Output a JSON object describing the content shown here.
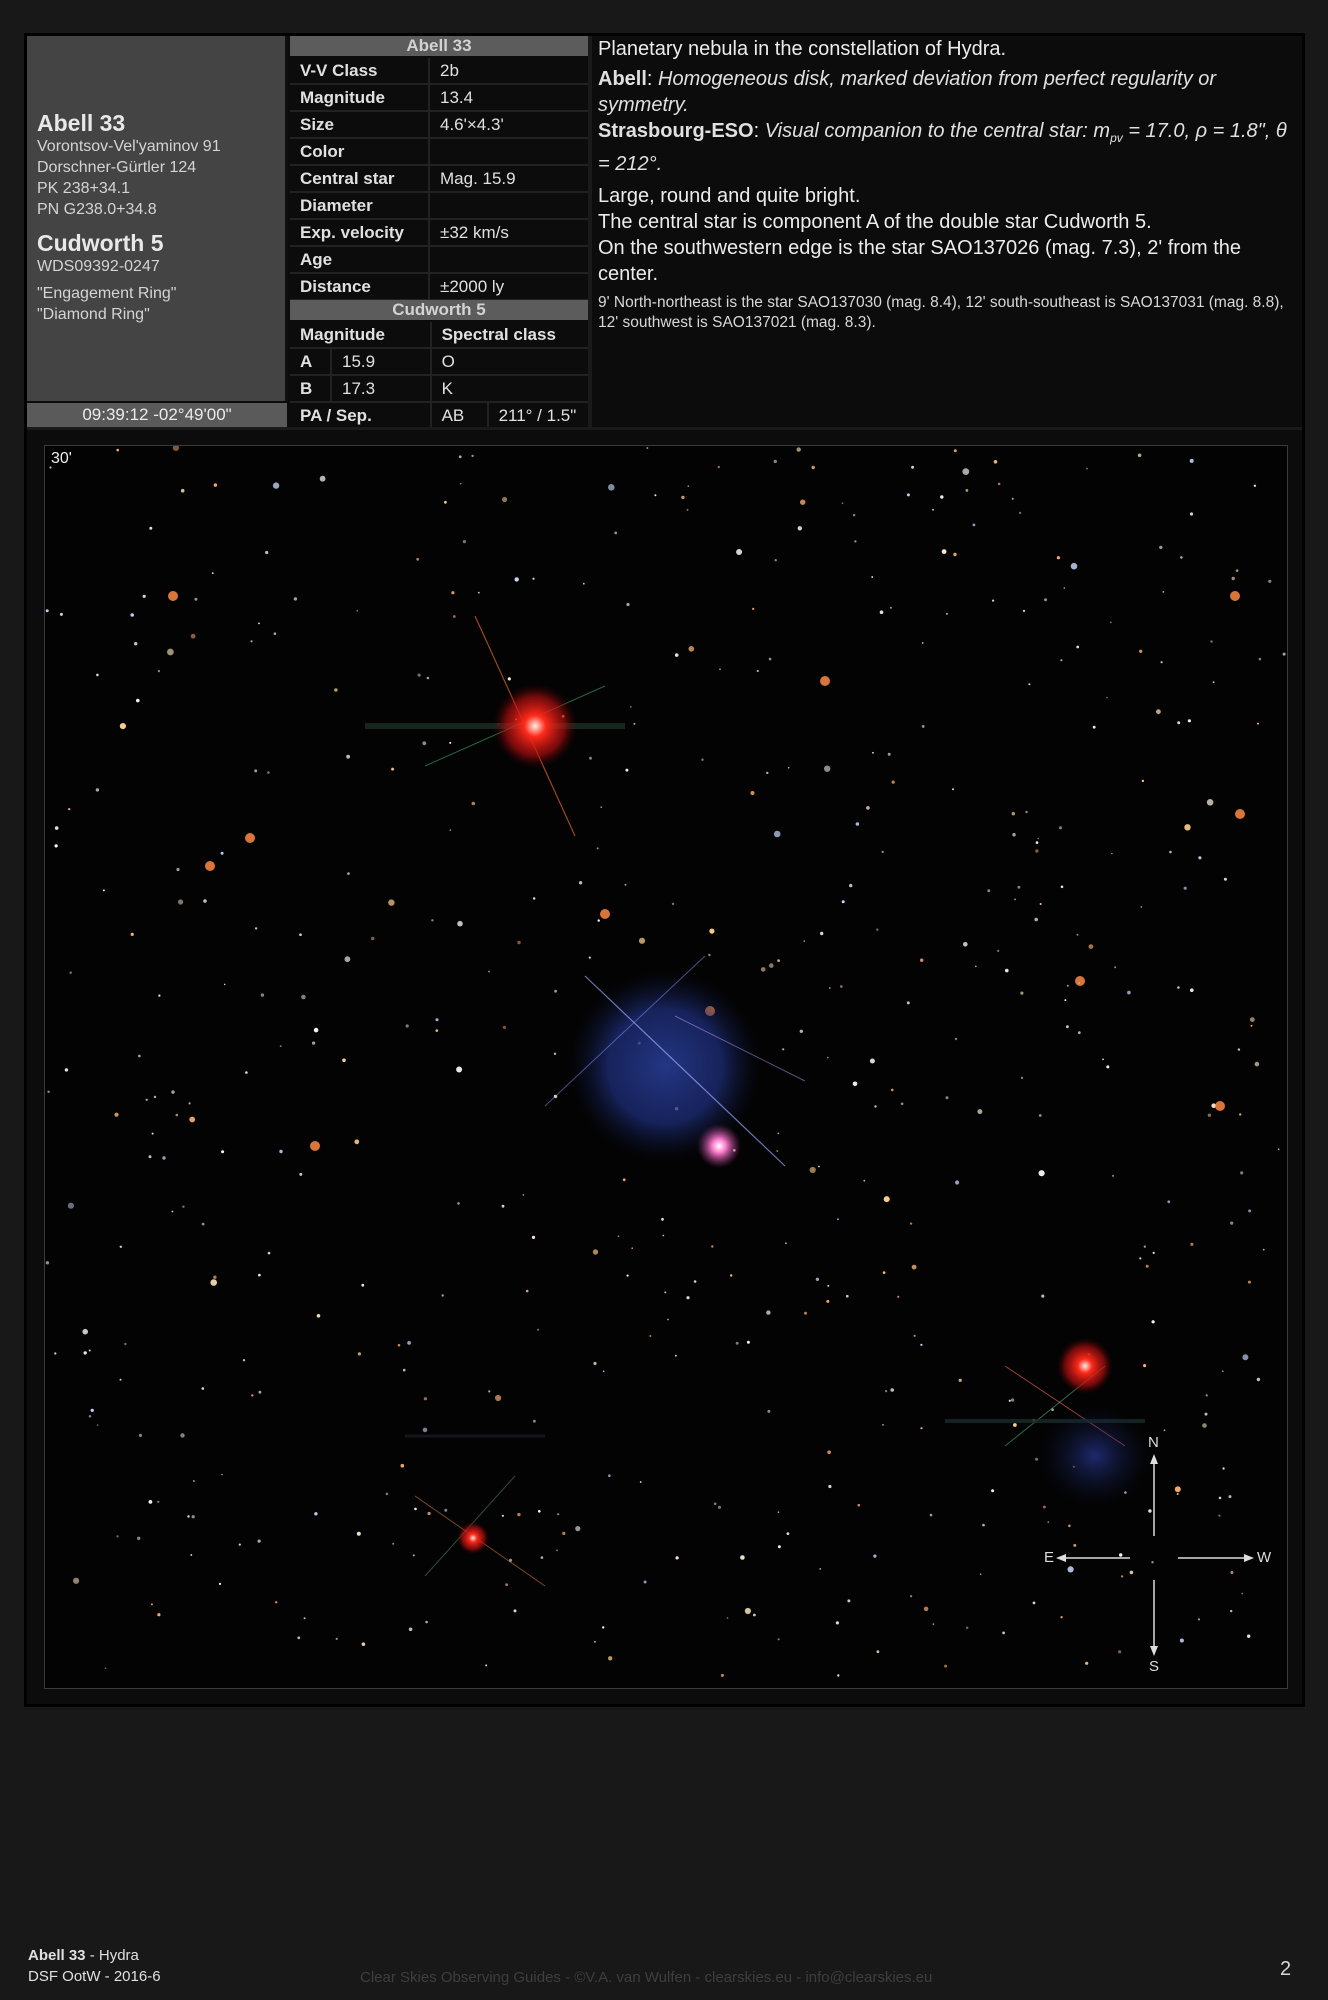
{
  "object": {
    "name": "Abell 33",
    "designations": [
      "Vorontsov-Vel'yaminov 91",
      "Dorschner-Gürtler 124",
      "PK 238+34.1",
      "PN G238.0+34.8"
    ],
    "double_star_name": "Cudworth 5",
    "wds": "WDS09392-0247",
    "nicknames": [
      "\"Engagement Ring\"",
      "\"Diamond Ring\""
    ],
    "coordinates": "09:39:12 -02°49'00\""
  },
  "properties": {
    "header": "Abell 33",
    "rows": [
      {
        "label": "V-V Class",
        "value": "2b"
      },
      {
        "label": "Magnitude",
        "value": "13.4"
      },
      {
        "label": "Size",
        "value": "4.6'×4.3'"
      },
      {
        "label": "Color",
        "value": ""
      },
      {
        "label": "Central star",
        "value": "Mag. 15.9"
      },
      {
        "label": "Diameter",
        "value": ""
      },
      {
        "label": "Exp. velocity",
        "value": "±32 km/s"
      },
      {
        "label": "Age",
        "value": ""
      },
      {
        "label": "Distance",
        "value": "±2000 ly"
      }
    ]
  },
  "double_star": {
    "header": "Cudworth 5",
    "col_magnitude": "Magnitude",
    "col_spectral": "Spectral class",
    "components": [
      {
        "id": "A",
        "mag": "15.9",
        "spec": "O"
      },
      {
        "id": "B",
        "mag": "17.3",
        "spec": "K"
      }
    ],
    "pa_label": "PA / Sep.",
    "pair": "AB",
    "pa_sep": "211° / 1.5\""
  },
  "description": {
    "intro": "Planetary nebula in the constellation of Hydra.",
    "abell_label": "Abell",
    "abell_text": "Homogeneous disk, marked deviation from perfect regularity or symmetry.",
    "eso_label": "Strasbourg-ESO",
    "eso_text": "Visual companion to the central star: m",
    "eso_sub": "pv",
    "eso_text2": " = 17.0, ρ = 1.8\", θ = 212°.",
    "visual": "Large, round and quite bright.",
    "central": "The central star is component A of the double star Cudworth 5.",
    "edge": "On the southwestern edge is the star SAO137026 (mag. 7.3), 2' from the center.",
    "nearby": "9' North-northeast is the star SAO137030 (mag. 8.4), 12' south-southeast is SAO137031 (mag. 8.8), 12' southwest is SAO137021 (mag. 8.3)."
  },
  "image": {
    "fov_label": "30'",
    "compass": {
      "n": "N",
      "s": "S",
      "e": "E",
      "w": "W"
    }
  },
  "footer": {
    "object": "Abell 33",
    "constellation": " - Hydra",
    "series": "DSF OotW - 2016-6",
    "credit": "Clear Skies Observing Guides - ©V.A. van Wulfen - clearskies.eu - info@clearskies.eu",
    "page": "2"
  }
}
